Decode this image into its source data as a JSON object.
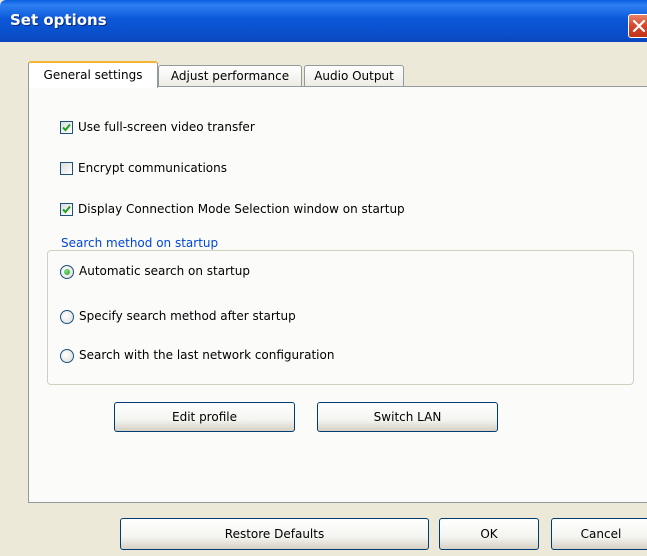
{
  "window": {
    "title": "Set options"
  },
  "tabs": [
    {
      "label": "General settings",
      "active": true
    },
    {
      "label": "Adjust performance",
      "active": false
    },
    {
      "label": "Audio Output",
      "active": false
    }
  ],
  "general": {
    "checkboxes": [
      {
        "label": "Use full-screen video transfer",
        "checked": true
      },
      {
        "label": "Encrypt communications",
        "checked": false
      },
      {
        "label": "Display Connection Mode Selection window on startup",
        "checked": true
      }
    ],
    "search_group": {
      "title": "Search method on startup",
      "options": [
        {
          "label": "Automatic search on startup",
          "selected": true
        },
        {
          "label": "Specify search method after startup",
          "selected": false
        },
        {
          "label": "Search with the last network configuration",
          "selected": false
        }
      ]
    },
    "buttons": {
      "edit_profile": "Edit profile",
      "switch_lan": "Switch LAN"
    }
  },
  "footer": {
    "restore": "Restore Defaults",
    "ok": "OK",
    "cancel": "Cancel"
  },
  "colors": {
    "titlebar": "#0a58d8",
    "dialog_bg": "#ece9d8",
    "group_title": "#0046d5",
    "tab_highlight": "#f6b535"
  }
}
